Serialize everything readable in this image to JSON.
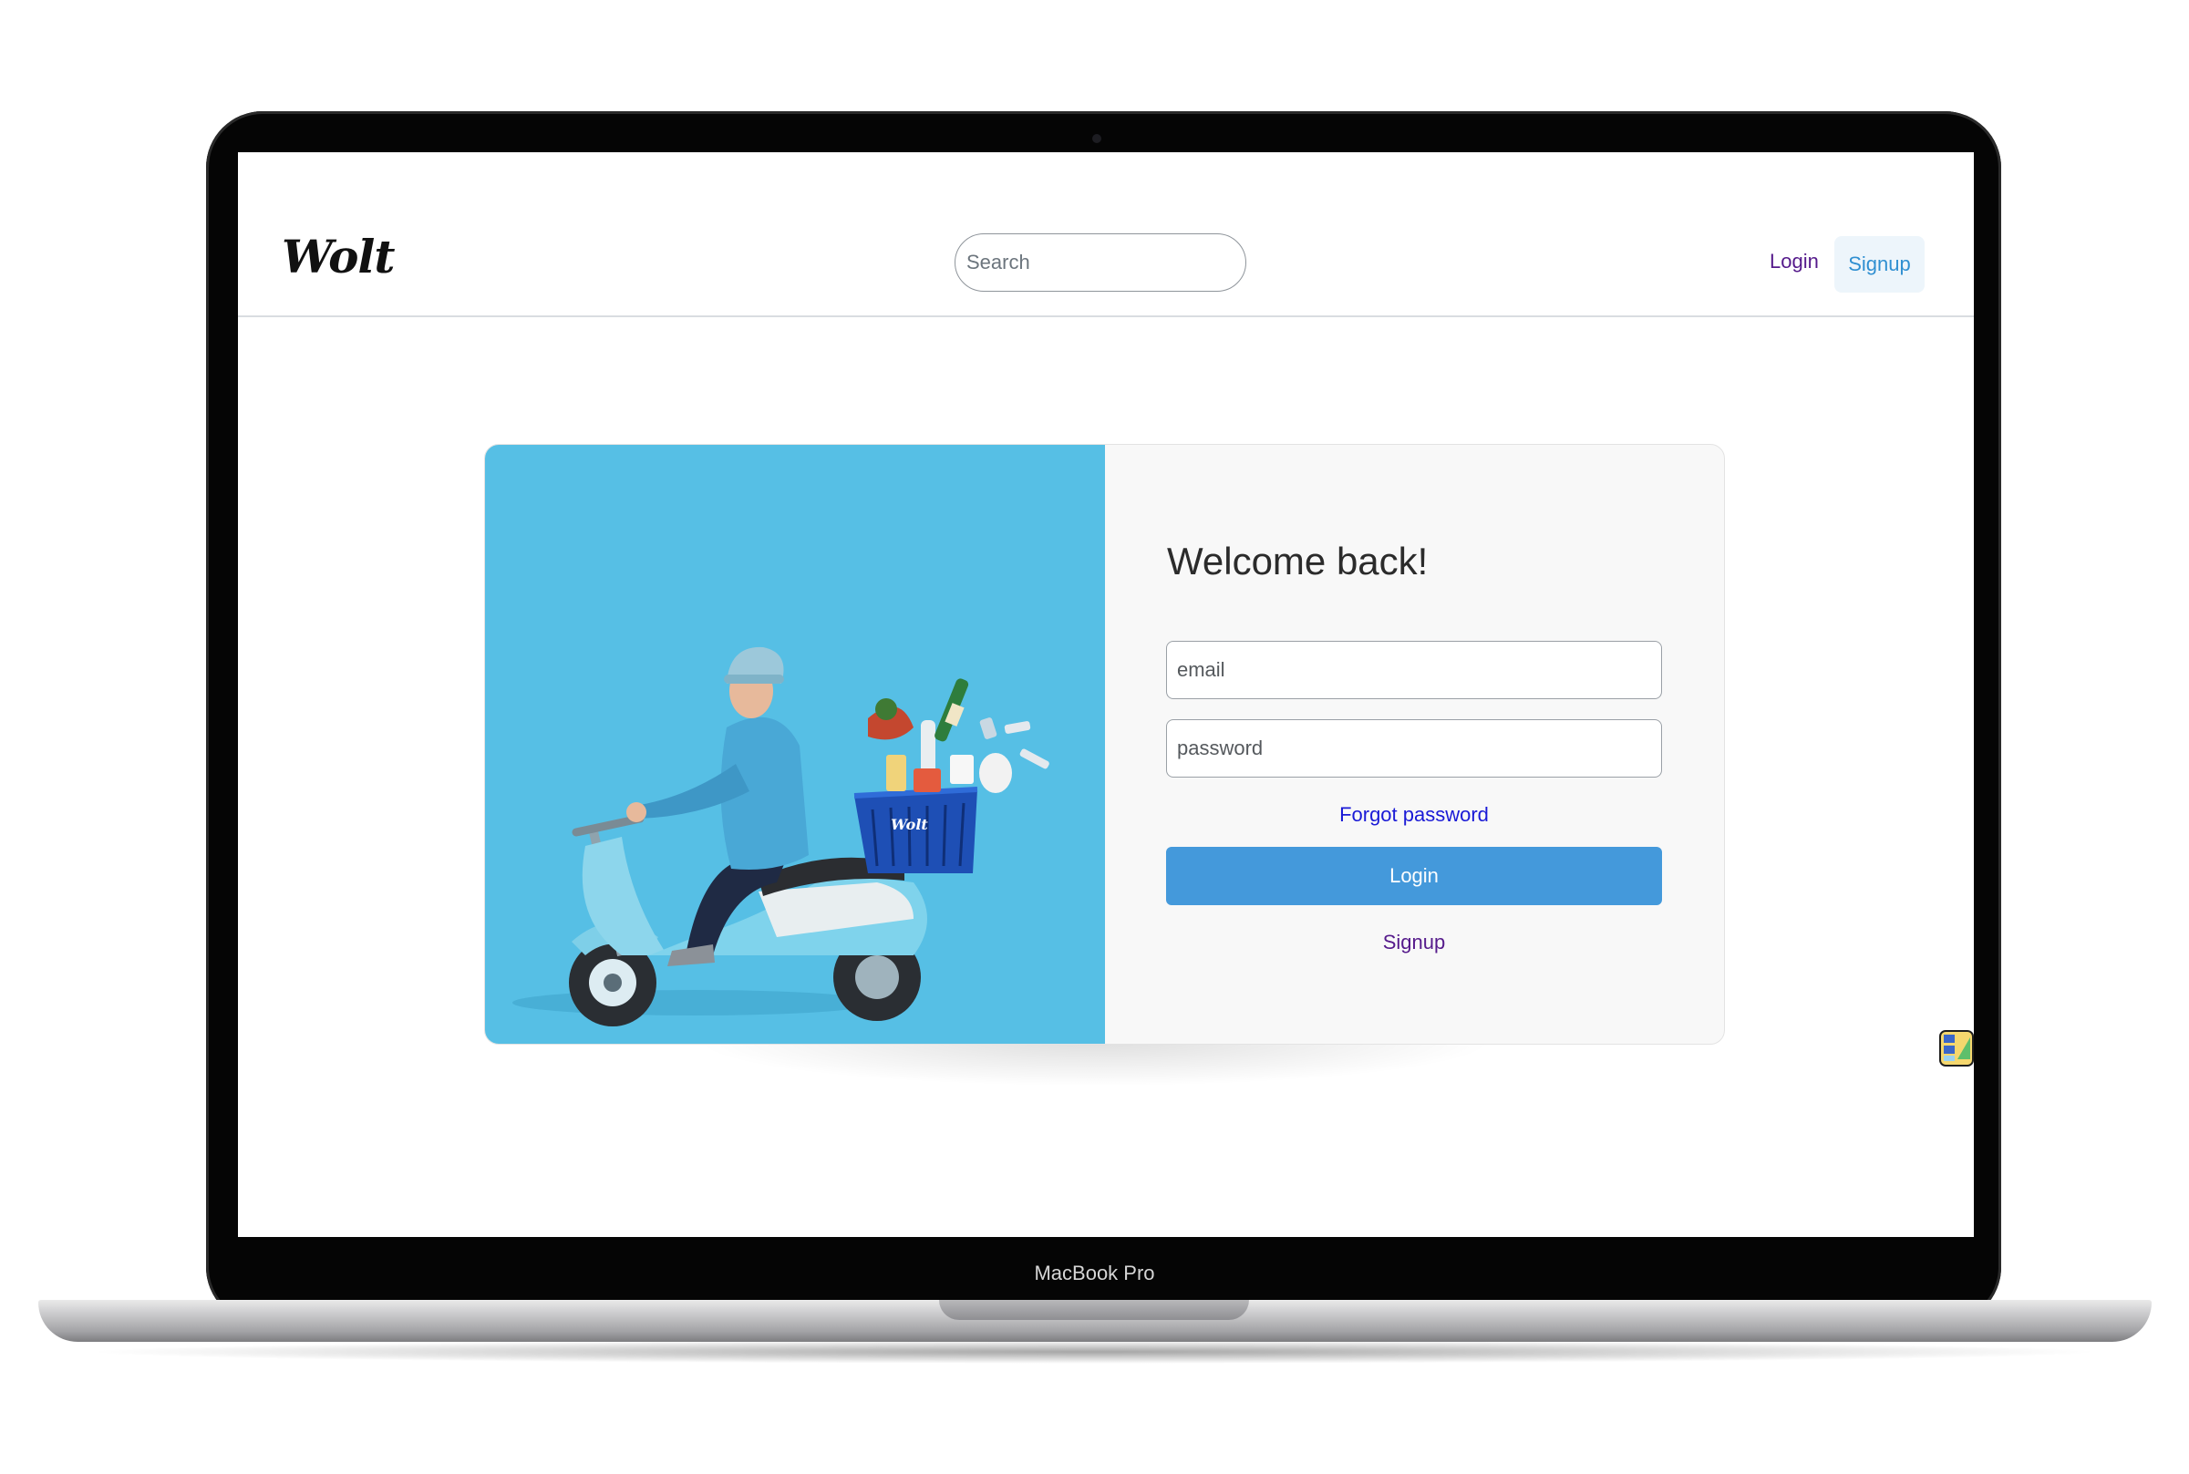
{
  "device": {
    "model_label": "MacBook Pro"
  },
  "navbar": {
    "logo": "Wolt",
    "search": {
      "placeholder": "Search",
      "value": ""
    },
    "login_label": "Login",
    "signup_label": "Signup"
  },
  "login_card": {
    "title": "Welcome back!",
    "email": {
      "placeholder": "email",
      "value": ""
    },
    "password": {
      "placeholder": "password",
      "value": ""
    },
    "forgot_password_label": "Forgot password",
    "login_button_label": "Login",
    "signup_label": "Signup",
    "hero_basket_text": "Wolt"
  },
  "colors": {
    "hero_background": "#56bfe5",
    "primary_button": "#4499db",
    "link": "#1a1ad6",
    "visited_link": "#551a8b"
  },
  "icons": [
    "scooter-courier-illustration",
    "extension-icon"
  ]
}
